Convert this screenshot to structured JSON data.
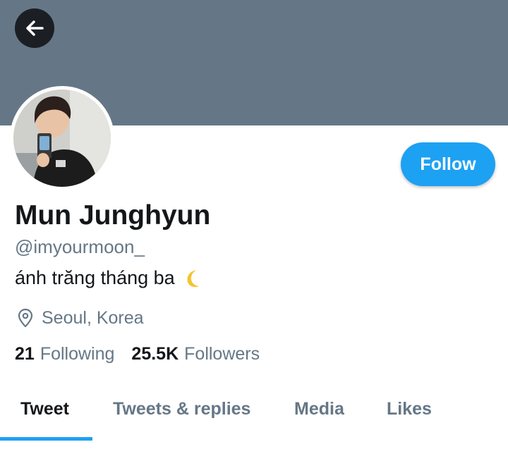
{
  "header": {
    "back_icon": "arrow-left-icon"
  },
  "profile": {
    "name": "Mun Junghyun",
    "handle": "@imyourmoon_",
    "bio": "ánh trăng tháng ba",
    "bio_emoji": "crescent-moon-icon",
    "location": "Seoul, Korea",
    "following_count": "21",
    "following_label": "Following",
    "followers_count": "25.5K",
    "followers_label": "Followers"
  },
  "actions": {
    "follow_label": "Follow"
  },
  "tabs": [
    {
      "label": "Tweet",
      "active": true
    },
    {
      "label": "Tweets & replies",
      "active": false
    },
    {
      "label": "Media",
      "active": false
    },
    {
      "label": "Likes",
      "active": false
    }
  ],
  "colors": {
    "banner": "#657786",
    "accent": "#1da1f2",
    "text_primary": "#14171a",
    "text_secondary": "#657786"
  }
}
